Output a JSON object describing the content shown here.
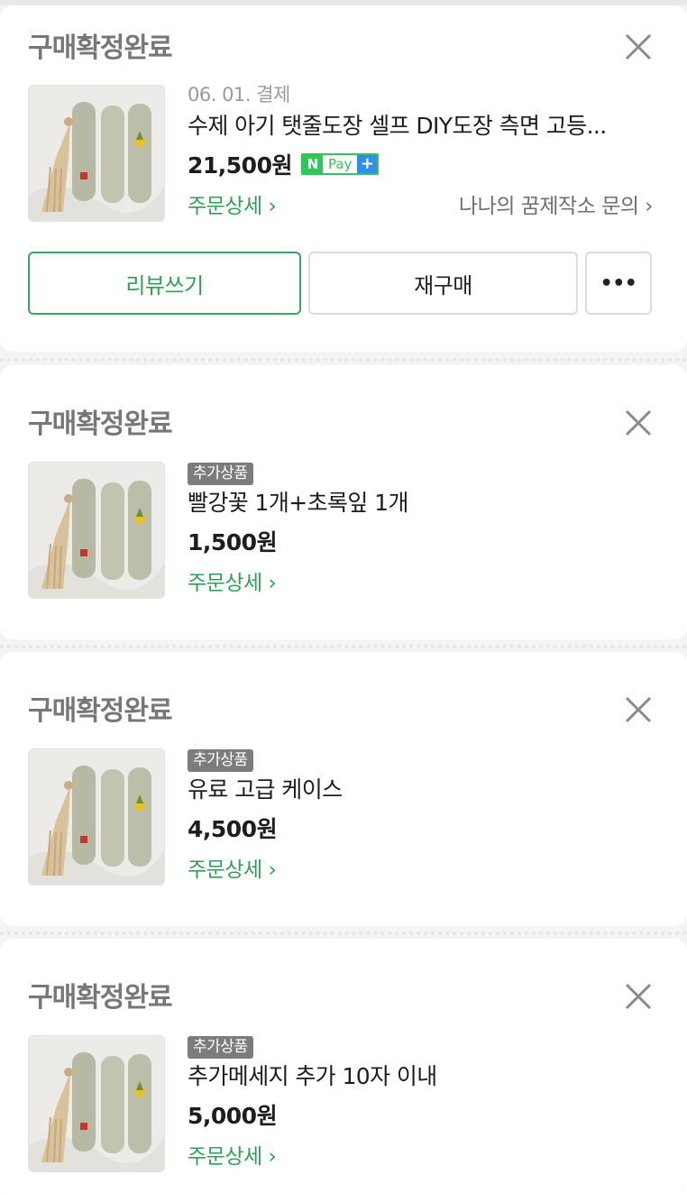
{
  "orders": [
    {
      "status": "구매확정완료",
      "date": "06. 01. 결제",
      "product_name": "수제 아기 탯줄도장 셀프 DIY도장 측면 고등...",
      "price": "21,500원",
      "npay": {
        "n": "N",
        "pay": "Pay",
        "plus": "+"
      },
      "detail_link": "주문상세 ›",
      "seller_link": "나나의 꿈제작소 문의 ›",
      "buttons": {
        "review": "리뷰쓰기",
        "rebuy": "재구매",
        "more": "•••"
      }
    },
    {
      "status": "구매확정완료",
      "tag": "추가상품",
      "product_name": "빨강꽃 1개+초록잎 1개",
      "price": "1,500원",
      "detail_link": "주문상세 ›"
    },
    {
      "status": "구매확정완료",
      "tag": "추가상품",
      "product_name": "유료 고급 케이스",
      "price": "4,500원",
      "detail_link": "주문상세 ›"
    },
    {
      "status": "구매확정완료",
      "tag": "추가상품",
      "product_name": "추가메세지 추가 10자 이내",
      "price": "5,000원",
      "detail_link": "주문상세 ›"
    }
  ],
  "icons": {
    "close": "close-icon",
    "thumbnail": "product-thumbnail"
  },
  "colors": {
    "accent_green": "#2ea155",
    "npay_green": "#2fc75b",
    "npay_blue": "#2f8ee8"
  }
}
